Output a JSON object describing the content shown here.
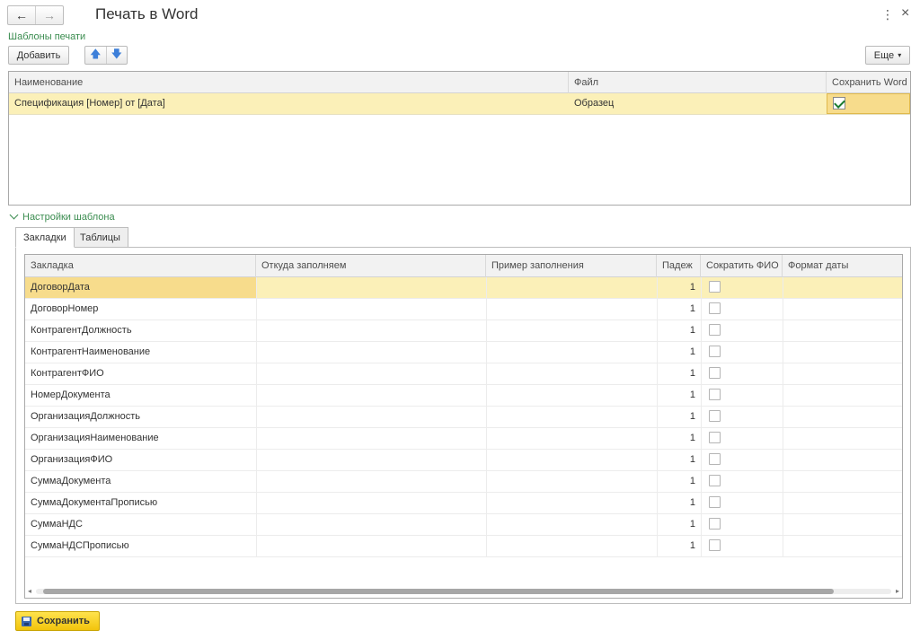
{
  "window": {
    "title": "Печать в Word",
    "back_icon": "←",
    "forward_icon": "→",
    "more_icon": "⋮",
    "close_icon": "×"
  },
  "templates_section": {
    "label": "Шаблоны печати",
    "add_button": "Добавить",
    "up_icon": "🡅",
    "down_icon": "🡇",
    "more_button": "Еще",
    "more_caret": "▾",
    "columns": [
      "Наименование",
      "Файл",
      "Сохранить Word"
    ],
    "rows": [
      {
        "name": "Спецификация [Номер] от [Дата]",
        "file": "Образец",
        "save_word": true
      }
    ]
  },
  "settings": {
    "label": "Настройки шаблона",
    "tabs": [
      "Закладки",
      "Таблицы"
    ],
    "active_tab": 0,
    "columns": [
      "Закладка",
      "Откуда заполняем",
      "Пример заполнения",
      "Падеж",
      "Сократить ФИО",
      "Формат даты"
    ],
    "rows": [
      {
        "bookmark": "ДоговорДата",
        "source": "",
        "example": "",
        "case": "1",
        "shorten": false,
        "date_format": ""
      },
      {
        "bookmark": "ДоговорНомер",
        "source": "",
        "example": "",
        "case": "1",
        "shorten": false,
        "date_format": ""
      },
      {
        "bookmark": "КонтрагентДолжность",
        "source": "",
        "example": "",
        "case": "1",
        "shorten": false,
        "date_format": ""
      },
      {
        "bookmark": "КонтрагентНаименование",
        "source": "",
        "example": "",
        "case": "1",
        "shorten": false,
        "date_format": ""
      },
      {
        "bookmark": "КонтрагентФИО",
        "source": "",
        "example": "",
        "case": "1",
        "shorten": false,
        "date_format": ""
      },
      {
        "bookmark": "НомерДокумента",
        "source": "",
        "example": "",
        "case": "1",
        "shorten": false,
        "date_format": ""
      },
      {
        "bookmark": "ОрганизацияДолжность",
        "source": "",
        "example": "",
        "case": "1",
        "shorten": false,
        "date_format": ""
      },
      {
        "bookmark": "ОрганизацияНаименование",
        "source": "",
        "example": "",
        "case": "1",
        "shorten": false,
        "date_format": ""
      },
      {
        "bookmark": "ОрганизацияФИО",
        "source": "",
        "example": "",
        "case": "1",
        "shorten": false,
        "date_format": ""
      },
      {
        "bookmark": "СуммаДокумента",
        "source": "",
        "example": "",
        "case": "1",
        "shorten": false,
        "date_format": ""
      },
      {
        "bookmark": "СуммаДокументаПрописью",
        "source": "",
        "example": "",
        "case": "1",
        "shorten": false,
        "date_format": ""
      },
      {
        "bookmark": "СуммаНДС",
        "source": "",
        "example": "",
        "case": "1",
        "shorten": false,
        "date_format": ""
      },
      {
        "bookmark": "СуммаНДСПрописью",
        "source": "",
        "example": "",
        "case": "1",
        "shorten": false,
        "date_format": ""
      }
    ],
    "scroll_left_icon": "◂",
    "scroll_right_icon": "▸"
  },
  "footer": {
    "save_button": "Сохранить"
  },
  "colors": {
    "accent_green": "#3a8c4f",
    "selected_row": "#fbf0b8",
    "save_button": "#f2c40c"
  }
}
